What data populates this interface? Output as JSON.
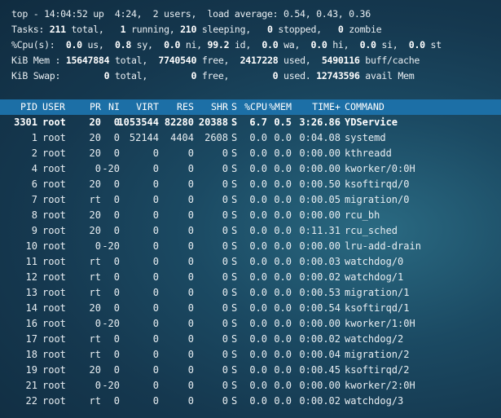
{
  "summary": {
    "line1": [
      {
        "t": "top - 14:04:52 up  4:24,  2 users,  load average: 0.54, 0.43, 0.36",
        "b": false
      }
    ],
    "line2": [
      {
        "t": "Tasks: ",
        "b": false
      },
      {
        "t": "211",
        "b": true
      },
      {
        "t": " total,   ",
        "b": false
      },
      {
        "t": "1",
        "b": true
      },
      {
        "t": " running, ",
        "b": false
      },
      {
        "t": "210",
        "b": true
      },
      {
        "t": " sleeping,   ",
        "b": false
      },
      {
        "t": "0",
        "b": true
      },
      {
        "t": " stopped,   ",
        "b": false
      },
      {
        "t": "0",
        "b": true
      },
      {
        "t": " zombie",
        "b": false
      }
    ],
    "line3": [
      {
        "t": "%Cpu(s):  ",
        "b": false
      },
      {
        "t": "0.0",
        "b": true
      },
      {
        "t": " us,  ",
        "b": false
      },
      {
        "t": "0.8",
        "b": true
      },
      {
        "t": " sy,  ",
        "b": false
      },
      {
        "t": "0.0",
        "b": true
      },
      {
        "t": " ni, ",
        "b": false
      },
      {
        "t": "99.2",
        "b": true
      },
      {
        "t": " id,  ",
        "b": false
      },
      {
        "t": "0.0",
        "b": true
      },
      {
        "t": " wa,  ",
        "b": false
      },
      {
        "t": "0.0",
        "b": true
      },
      {
        "t": " hi,  ",
        "b": false
      },
      {
        "t": "0.0",
        "b": true
      },
      {
        "t": " si,  ",
        "b": false
      },
      {
        "t": "0.0",
        "b": true
      },
      {
        "t": " st",
        "b": false
      }
    ],
    "line4": [
      {
        "t": "KiB Mem : ",
        "b": false
      },
      {
        "t": "15647884",
        "b": true
      },
      {
        "t": " total,  ",
        "b": false
      },
      {
        "t": "7740540",
        "b": true
      },
      {
        "t": " free,  ",
        "b": false
      },
      {
        "t": "2417228",
        "b": true
      },
      {
        "t": " used,  ",
        "b": false
      },
      {
        "t": "5490116",
        "b": true
      },
      {
        "t": " buff/cache",
        "b": false
      }
    ],
    "line5": [
      {
        "t": "KiB Swap:        ",
        "b": false
      },
      {
        "t": "0",
        "b": true
      },
      {
        "t": " total,        ",
        "b": false
      },
      {
        "t": "0",
        "b": true
      },
      {
        "t": " free,        ",
        "b": false
      },
      {
        "t": "0",
        "b": true
      },
      {
        "t": " used. ",
        "b": false
      },
      {
        "t": "12743596",
        "b": true
      },
      {
        "t": " avail Mem",
        "b": false
      }
    ]
  },
  "columns": [
    "PID",
    "USER",
    "PR",
    "NI",
    "VIRT",
    "RES",
    "SHR",
    "S",
    "%CPU",
    "%MEM",
    "TIME+",
    "COMMAND"
  ],
  "processes": [
    [
      "3301",
      "root",
      "20",
      "0",
      "1053544",
      "82280",
      "20388",
      "S",
      "6.7",
      "0.5",
      "3:26.86",
      "YDService"
    ],
    [
      "1",
      "root",
      "20",
      "0",
      "52144",
      "4404",
      "2608",
      "S",
      "0.0",
      "0.0",
      "0:04.08",
      "systemd"
    ],
    [
      "2",
      "root",
      "20",
      "0",
      "0",
      "0",
      "0",
      "S",
      "0.0",
      "0.0",
      "0:00.00",
      "kthreadd"
    ],
    [
      "4",
      "root",
      "0",
      "-20",
      "0",
      "0",
      "0",
      "S",
      "0.0",
      "0.0",
      "0:00.00",
      "kworker/0:0H"
    ],
    [
      "6",
      "root",
      "20",
      "0",
      "0",
      "0",
      "0",
      "S",
      "0.0",
      "0.0",
      "0:00.50",
      "ksoftirqd/0"
    ],
    [
      "7",
      "root",
      "rt",
      "0",
      "0",
      "0",
      "0",
      "S",
      "0.0",
      "0.0",
      "0:00.05",
      "migration/0"
    ],
    [
      "8",
      "root",
      "20",
      "0",
      "0",
      "0",
      "0",
      "S",
      "0.0",
      "0.0",
      "0:00.00",
      "rcu_bh"
    ],
    [
      "9",
      "root",
      "20",
      "0",
      "0",
      "0",
      "0",
      "S",
      "0.0",
      "0.0",
      "0:11.31",
      "rcu_sched"
    ],
    [
      "10",
      "root",
      "0",
      "-20",
      "0",
      "0",
      "0",
      "S",
      "0.0",
      "0.0",
      "0:00.00",
      "lru-add-drain"
    ],
    [
      "11",
      "root",
      "rt",
      "0",
      "0",
      "0",
      "0",
      "S",
      "0.0",
      "0.0",
      "0:00.03",
      "watchdog/0"
    ],
    [
      "12",
      "root",
      "rt",
      "0",
      "0",
      "0",
      "0",
      "S",
      "0.0",
      "0.0",
      "0:00.02",
      "watchdog/1"
    ],
    [
      "13",
      "root",
      "rt",
      "0",
      "0",
      "0",
      "0",
      "S",
      "0.0",
      "0.0",
      "0:00.53",
      "migration/1"
    ],
    [
      "14",
      "root",
      "20",
      "0",
      "0",
      "0",
      "0",
      "S",
      "0.0",
      "0.0",
      "0:00.54",
      "ksoftirqd/1"
    ],
    [
      "16",
      "root",
      "0",
      "-20",
      "0",
      "0",
      "0",
      "S",
      "0.0",
      "0.0",
      "0:00.00",
      "kworker/1:0H"
    ],
    [
      "17",
      "root",
      "rt",
      "0",
      "0",
      "0",
      "0",
      "S",
      "0.0",
      "0.0",
      "0:00.02",
      "watchdog/2"
    ],
    [
      "18",
      "root",
      "rt",
      "0",
      "0",
      "0",
      "0",
      "S",
      "0.0",
      "0.0",
      "0:00.04",
      "migration/2"
    ],
    [
      "19",
      "root",
      "20",
      "0",
      "0",
      "0",
      "0",
      "S",
      "0.0",
      "0.0",
      "0:00.45",
      "ksoftirqd/2"
    ],
    [
      "21",
      "root",
      "0",
      "-20",
      "0",
      "0",
      "0",
      "S",
      "0.0",
      "0.0",
      "0:00.00",
      "kworker/2:0H"
    ],
    [
      "22",
      "root",
      "rt",
      "0",
      "0",
      "0",
      "0",
      "S",
      "0.0",
      "0.0",
      "0:00.02",
      "watchdog/3"
    ]
  ]
}
